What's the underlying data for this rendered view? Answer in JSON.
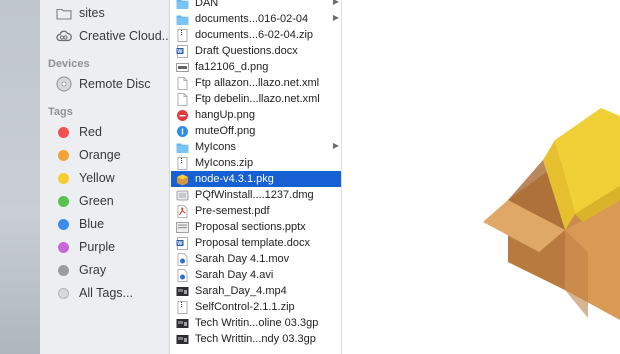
{
  "sidebar": {
    "items_top": [
      {
        "label": "sites",
        "icon": "folder-icon"
      },
      {
        "label": "Creative Cloud...",
        "icon": "creative-cloud-icon"
      }
    ],
    "devices_header": "Devices",
    "devices": [
      {
        "label": "Remote Disc",
        "icon": "disc-icon"
      }
    ],
    "tags_header": "Tags",
    "tags": [
      {
        "label": "Red",
        "color": "#f0534f"
      },
      {
        "label": "Orange",
        "color": "#f5a13a"
      },
      {
        "label": "Yellow",
        "color": "#f6cf2f"
      },
      {
        "label": "Green",
        "color": "#58c24f"
      },
      {
        "label": "Blue",
        "color": "#3b8cf0"
      },
      {
        "label": "Purple",
        "color": "#c868d8"
      },
      {
        "label": "Gray",
        "color": "#9b9ba0"
      },
      {
        "label": "All Tags...",
        "color": "#d9d9dc"
      }
    ]
  },
  "files": [
    {
      "name": "DAN",
      "icon": "folder-icon",
      "has_arrow": true
    },
    {
      "name": "documents...016-02-04",
      "icon": "folder-icon",
      "has_arrow": true
    },
    {
      "name": "documents...6-02-04.zip",
      "icon": "zip-icon"
    },
    {
      "name": "Draft Questions.docx",
      "icon": "word-doc-icon"
    },
    {
      "name": "fa12106_d.png",
      "icon": "image-icon"
    },
    {
      "name": "Ftp allazon...llazo.net.xml",
      "icon": "xml-icon"
    },
    {
      "name": "Ftp debelin...llazo.net.xml",
      "icon": "xml-icon"
    },
    {
      "name": "hangUp.png",
      "icon": "red-circle-icon"
    },
    {
      "name": "muteOff.png",
      "icon": "blue-circle-icon"
    },
    {
      "name": "MyIcons",
      "icon": "folder-icon",
      "has_arrow": true
    },
    {
      "name": "MyIcons.zip",
      "icon": "zip-icon"
    },
    {
      "name": "node-v4.3.1.pkg",
      "icon": "package-icon",
      "selected": true
    },
    {
      "name": "PQfWinstall....1237.dmg",
      "icon": "dmg-icon"
    },
    {
      "name": "Pre-semest.pdf",
      "icon": "pdf-icon"
    },
    {
      "name": "Proposal sections.pptx",
      "icon": "pptx-icon"
    },
    {
      "name": "Proposal template.docx",
      "icon": "word-doc-icon"
    },
    {
      "name": "Sarah Day 4.1.mov",
      "icon": "movie-icon"
    },
    {
      "name": "Sarah Day 4.avi",
      "icon": "movie-icon"
    },
    {
      "name": "Sarah_Day_4.mp4",
      "icon": "video-thumb-icon"
    },
    {
      "name": "SelfControl-2.1.1.zip",
      "icon": "zip-icon"
    },
    {
      "name": "Tech Writin...oline 03.3gp",
      "icon": "video-thumb-icon"
    },
    {
      "name": "Tech Writtin...ndy 03.3gp",
      "icon": "video-thumb-icon"
    }
  ],
  "preview": {
    "icon": "package-preview-icon"
  }
}
